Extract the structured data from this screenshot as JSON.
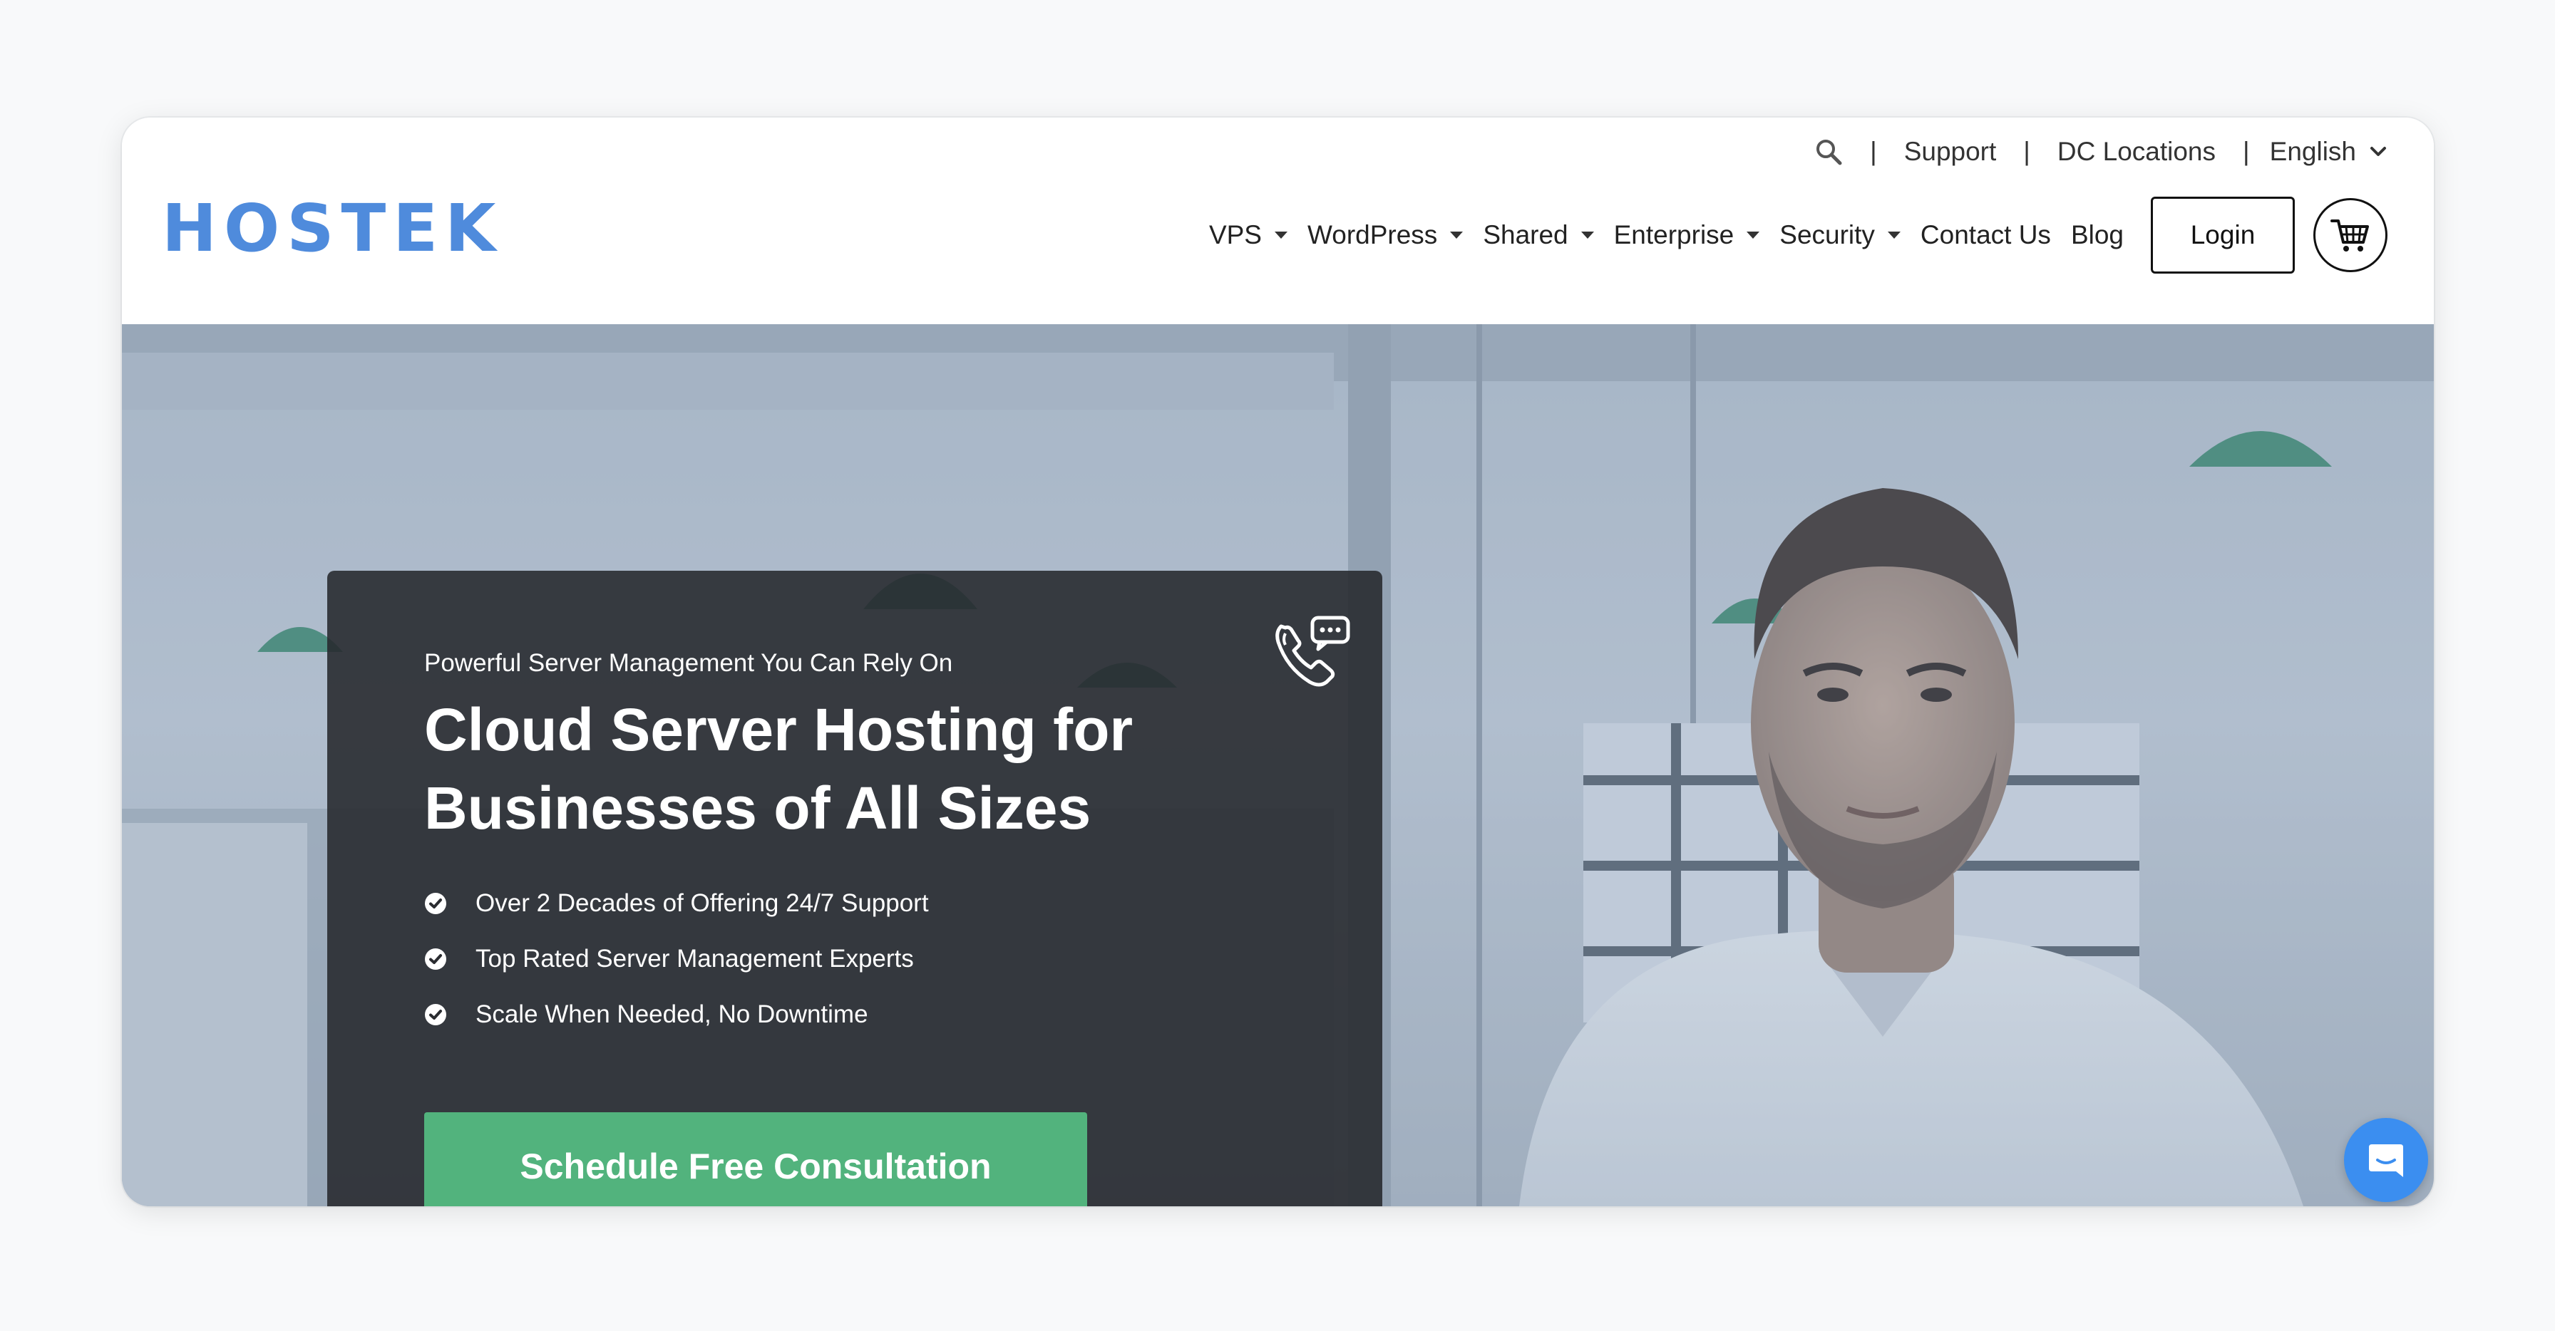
{
  "topbar": {
    "support": "Support",
    "dc_locations": "DC Locations",
    "language": "English",
    "separator": "|"
  },
  "logo": {
    "text": "HOSTEK"
  },
  "nav": {
    "items": [
      {
        "label": "VPS",
        "dropdown": true
      },
      {
        "label": "WordPress",
        "dropdown": true
      },
      {
        "label": "Shared",
        "dropdown": true
      },
      {
        "label": "Enterprise",
        "dropdown": true
      },
      {
        "label": "Security",
        "dropdown": true
      },
      {
        "label": "Contact Us",
        "dropdown": false
      },
      {
        "label": "Blog",
        "dropdown": false
      }
    ],
    "login_label": "Login"
  },
  "hero": {
    "eyebrow": "Powerful Server Management You Can Rely On",
    "title_line1": "Cloud Server Hosting for",
    "title_line2": "Businesses of All Sizes",
    "features": [
      "Over 2 Decades of Offering 24/7 Support",
      "Top Rated Server Management Experts",
      "Scale When Needed, No Downtime"
    ],
    "cta_label": "Schedule Free Consultation"
  },
  "icons": {
    "search": "search-icon",
    "language_chevron": "chevron-down-icon",
    "cart": "cart-icon",
    "phone_chat": "phone-chat-icon",
    "check": "check-circle-icon",
    "chat_widget": "chat-bubble-icon"
  },
  "colors": {
    "brand": "#4f8bdc",
    "cta": "#52b37d",
    "card": "#26282c",
    "chat_widget": "#3b8ef0"
  }
}
